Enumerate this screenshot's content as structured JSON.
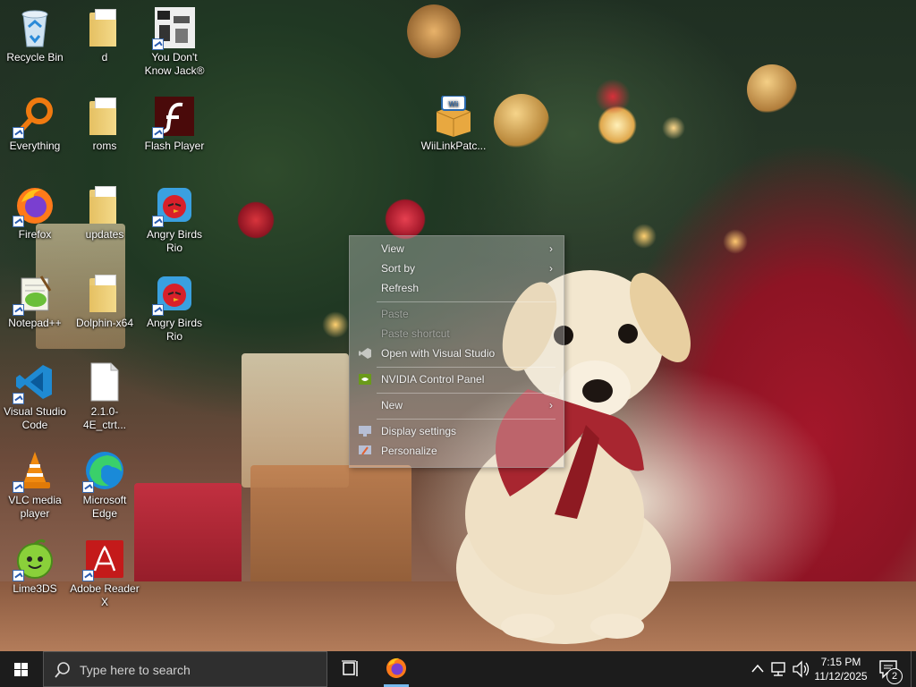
{
  "desktop_icons": [
    {
      "label": "Recycle Bin",
      "icon": "recycle-bin-icon"
    },
    {
      "label": "d",
      "icon": "folder-icon"
    },
    {
      "label": "You Don't Know Jack®",
      "icon": "game-icon"
    },
    {
      "label": "Everything",
      "icon": "search-magnifier-icon"
    },
    {
      "label": "roms",
      "icon": "folder-icon"
    },
    {
      "label": "Flash Player",
      "icon": "flash-icon"
    },
    {
      "label": "WiiLinkPatc...",
      "icon": "package-icon"
    },
    {
      "label": "Firefox",
      "icon": "firefox-icon"
    },
    {
      "label": "updates",
      "icon": "folder-icon"
    },
    {
      "label": "Angry Birds Rio",
      "icon": "angry-birds-icon"
    },
    {
      "label": "Notepad++",
      "icon": "notepadpp-icon"
    },
    {
      "label": "Dolphin-x64",
      "icon": "folder-icon"
    },
    {
      "label": "Angry Birds Rio",
      "icon": "angry-birds-icon"
    },
    {
      "label": "Visual Studio Code",
      "icon": "vscode-icon"
    },
    {
      "label": "2.1.0-4E_ctrt...",
      "icon": "file-icon"
    },
    {
      "label": "VLC media player",
      "icon": "vlc-icon"
    },
    {
      "label": "Microsoft Edge",
      "icon": "edge-icon"
    },
    {
      "label": "Lime3DS",
      "icon": "lime-icon"
    },
    {
      "label": "Adobe Reader X",
      "icon": "adobe-reader-icon"
    }
  ],
  "context_menu": {
    "items": [
      {
        "label": "View",
        "submenu": true,
        "enabled": true
      },
      {
        "label": "Sort by",
        "submenu": true,
        "enabled": true
      },
      {
        "label": "Refresh",
        "submenu": false,
        "enabled": true
      },
      {
        "label": "Paste",
        "submenu": false,
        "enabled": false
      },
      {
        "label": "Paste shortcut",
        "submenu": false,
        "enabled": false
      },
      {
        "label": "Open with Visual Studio",
        "submenu": false,
        "enabled": true
      },
      {
        "label": "NVIDIA Control Panel",
        "submenu": false,
        "enabled": true
      },
      {
        "label": "New",
        "submenu": true,
        "enabled": true
      },
      {
        "label": "Display settings",
        "submenu": false,
        "enabled": true
      },
      {
        "label": "Personalize",
        "submenu": false,
        "enabled": true
      }
    ]
  },
  "taskbar": {
    "search_placeholder": "Type here to search",
    "clock_time": "7:15 PM",
    "clock_date": "11/12/2025",
    "notification_count": "2"
  },
  "colors": {
    "taskbar_bg": "#1c1c1c",
    "accent": "#0078d7"
  }
}
